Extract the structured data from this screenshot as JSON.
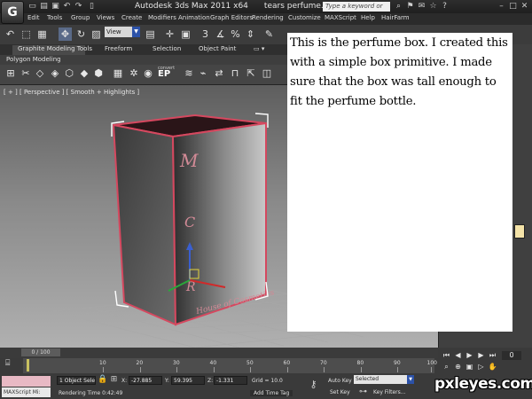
{
  "titlebar": {
    "app_name": "Autodesk 3ds Max  2011 x64",
    "file_name": "tears perfume.max",
    "search_placeholder": "Type a keyword or phrase"
  },
  "menu": [
    "Edit",
    "Tools",
    "Group",
    "Views",
    "Create",
    "Modifiers",
    "Animation",
    "Graph Editors",
    "Rendering",
    "Customize",
    "MAXScript",
    "Help",
    "HairFarm"
  ],
  "toolbar": {
    "view_dropdown": "View",
    "number_label": "3"
  },
  "ribbon": {
    "tabs": [
      "Graphite Modeling Tools",
      "Freeform",
      "Selection",
      "Object Paint"
    ],
    "sub_label": "Polygon Modeling",
    "convert_label": "convert",
    "ep_label": "EP"
  },
  "viewport": {
    "label": "[ + ] [ Perspective ] [ Smooth + Highlights ]",
    "box_lettering": [
      "M",
      "C",
      "R",
      "House of Cosmetics"
    ]
  },
  "note": {
    "text": "This is the perfume box.  I created this with a simple box primitive.  I made sure that the box was tall enough to fit the perfume bottle."
  },
  "timeline": {
    "slider_label": "0 / 100",
    "ticks": [
      "10",
      "20",
      "30",
      "40",
      "50",
      "60",
      "70",
      "80",
      "90",
      "100"
    ]
  },
  "status": {
    "maxscript_label": "MAXScript Mi:",
    "selection": "1 Object Sele",
    "x_label": "X:",
    "x_value": "-27.885",
    "y_label": "Y:",
    "y_value": "59.395",
    "z_label": "Z:",
    "z_value": "-1.331",
    "grid": "Grid = 10.0",
    "auto_key": "Auto Key",
    "set_key": "Set Key",
    "set_key_mode": "Selected",
    "key_filters": "Key Filters...",
    "rendering_time": "Rendering Time  0:42:49",
    "add_time_tag": "Add Time Tag"
  },
  "watermark": "pxleyes.com",
  "colors": {
    "box_edge": "#c0394f",
    "selection_white": "#ffffff",
    "note_bg": "#ffffff"
  }
}
